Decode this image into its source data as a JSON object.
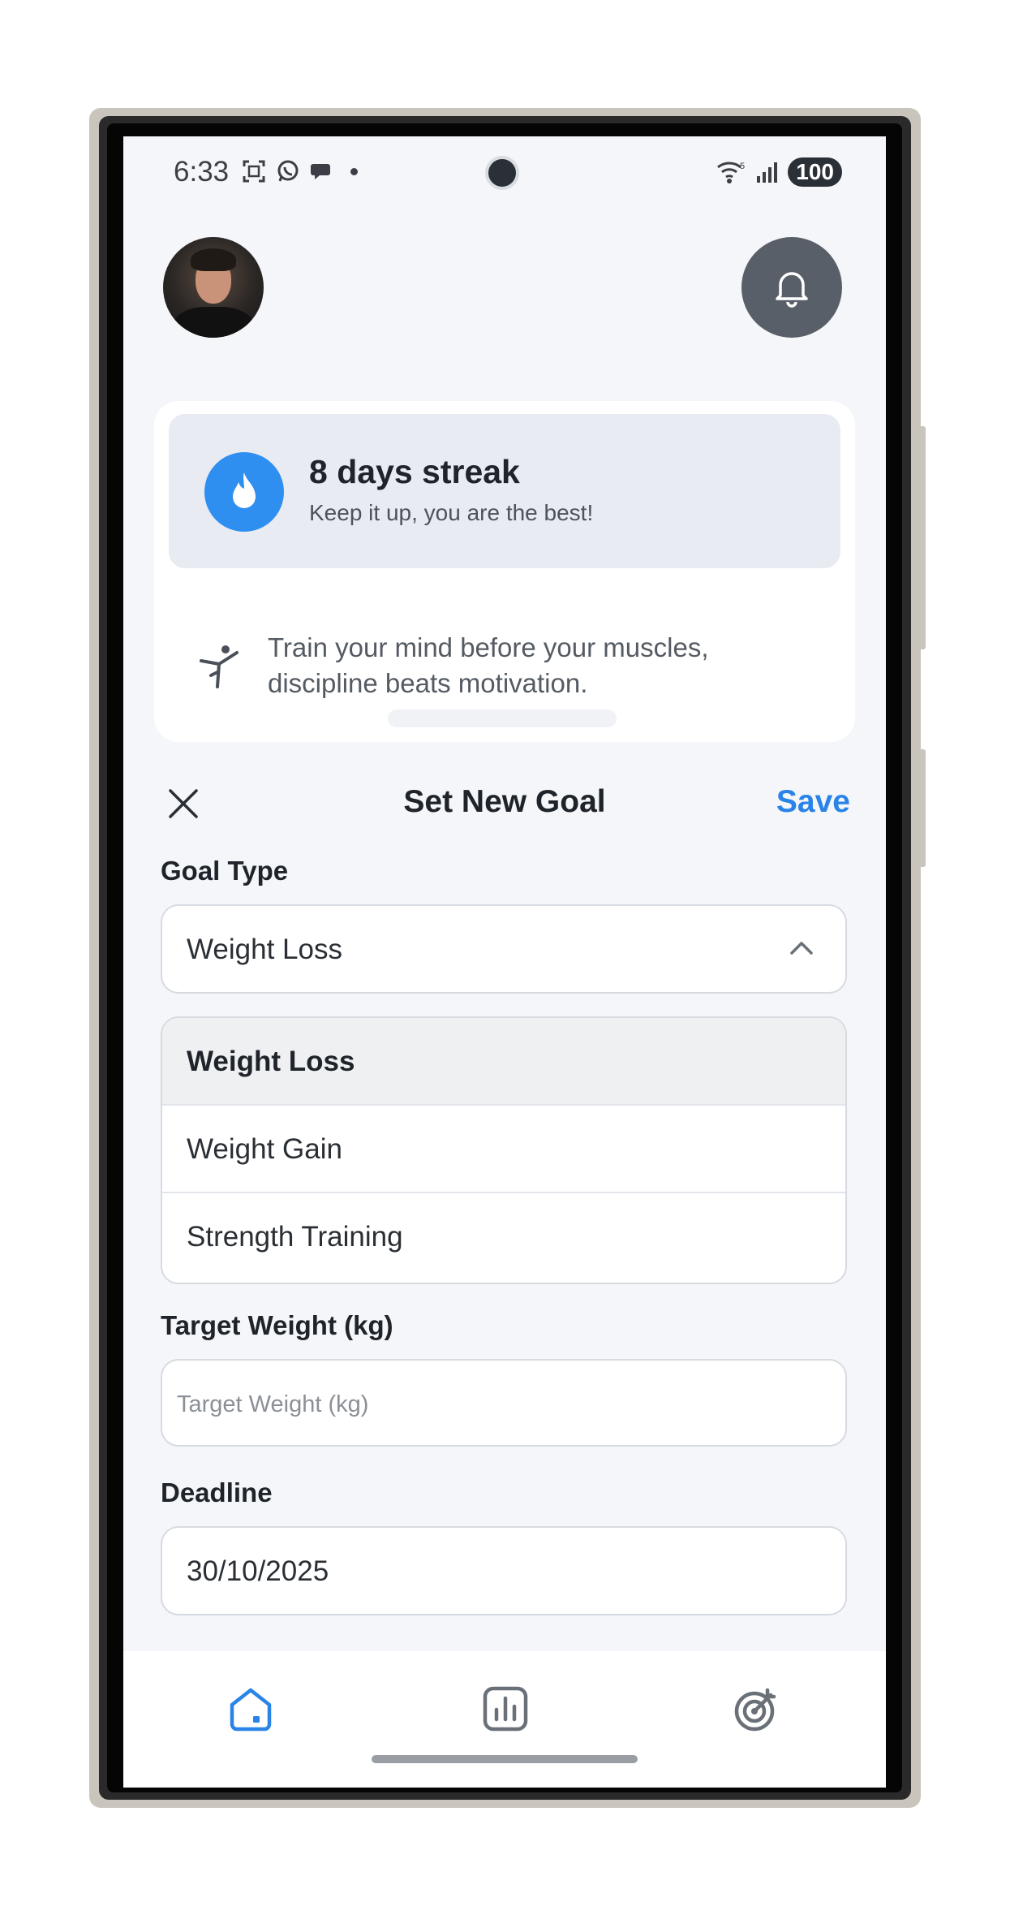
{
  "status_bar": {
    "time": "6:33",
    "battery": "100"
  },
  "streak": {
    "title": "8 days streak",
    "subtitle": "Keep it up, you are the best!"
  },
  "quote": "Train your mind before your muscles, discipline beats motivation.",
  "sheet": {
    "title": "Set New Goal",
    "save_label": "Save"
  },
  "goal_type": {
    "label": "Goal Type",
    "value": "Weight Loss",
    "options": [
      "Weight Loss",
      "Weight Gain",
      "Strength Training"
    ]
  },
  "target_weight": {
    "label": "Target Weight (kg)",
    "placeholder": "Target Weight (kg)"
  },
  "deadline": {
    "label": "Deadline",
    "value": "30/10/2025"
  },
  "colors": {
    "accent": "#2a84e8",
    "flame_bg": "#2f8ff0",
    "bell_bg": "#585f69"
  },
  "nav": {
    "items": [
      "home-icon",
      "chart-icon",
      "goal-icon"
    ]
  }
}
